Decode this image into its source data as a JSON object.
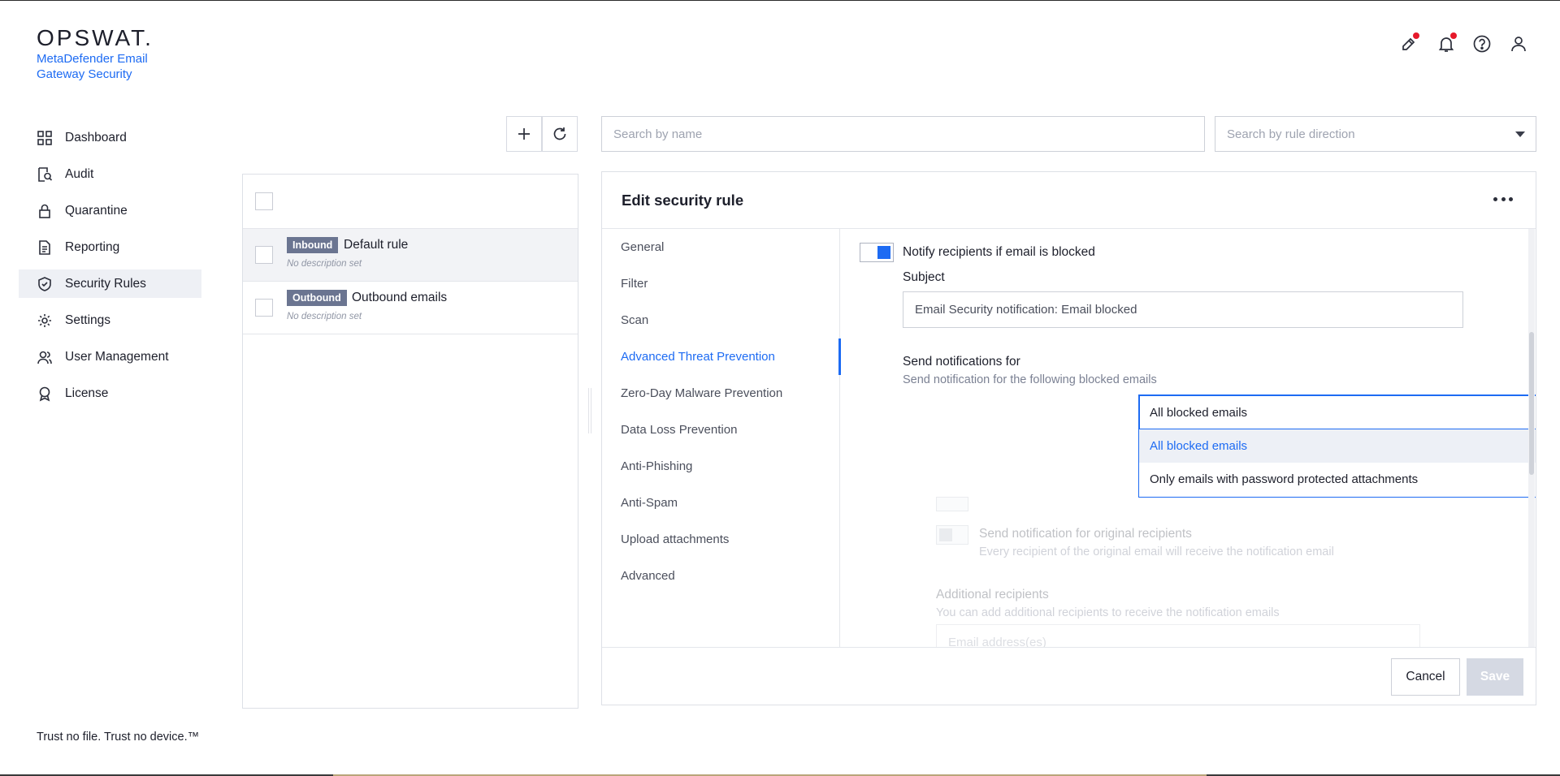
{
  "brand": {
    "logo": "OPSWAT.",
    "product": "MetaDefender Email Gateway Security",
    "tagline": "Trust no file. Trust no device.™"
  },
  "sidebar": {
    "items": [
      {
        "label": "Dashboard",
        "icon": "dashboard-icon"
      },
      {
        "label": "Audit",
        "icon": "audit-icon"
      },
      {
        "label": "Quarantine",
        "icon": "lock-icon"
      },
      {
        "label": "Reporting",
        "icon": "document-icon"
      },
      {
        "label": "Security Rules",
        "icon": "shield-check-icon",
        "active": true
      },
      {
        "label": "Settings",
        "icon": "gear-icon"
      },
      {
        "label": "User Management",
        "icon": "users-icon"
      },
      {
        "label": "License",
        "icon": "award-icon"
      }
    ]
  },
  "topbar": {
    "icons": [
      "tools-icon",
      "bell-icon",
      "help-icon",
      "user-icon"
    ],
    "notification_color": "#e6192b"
  },
  "rules": {
    "items": [
      {
        "direction": "Inbound",
        "name": "Default rule",
        "description": "No description set",
        "selected": true
      },
      {
        "direction": "Outbound",
        "name": "Outbound emails",
        "description": "No description set",
        "selected": false
      }
    ]
  },
  "search": {
    "name_placeholder": "Search by name",
    "direction_placeholder": "Search by rule direction"
  },
  "editor": {
    "title": "Edit security rule",
    "tabs": [
      "General",
      "Filter",
      "Scan",
      "Advanced Threat Prevention",
      "Zero-Day Malware Prevention",
      "Data Loss Prevention",
      "Anti-Phishing",
      "Anti-Spam",
      "Upload attachments",
      "Advanced"
    ],
    "active_tab": "Advanced Threat Prevention",
    "notify_toggle_label": "Notify recipients if email is blocked",
    "subject_label": "Subject",
    "subject_value": "Email Security notification: Email blocked",
    "send_for_label": "Send notifications for",
    "send_for_sub": "Send notification for the following blocked emails",
    "send_for_value": "All blocked emails",
    "send_for_options": [
      "All blocked emails",
      "Only emails with password protected attachments"
    ],
    "original_recipients_label": "Send notification for original recipients",
    "original_recipients_sub": "Every recipient of the original email will receive the notification email",
    "additional_label": "Additional recipients",
    "additional_sub": "You can add additional recipients to receive the notification emails",
    "additional_placeholder": "Email address(es)",
    "cancel_label": "Cancel",
    "save_label": "Save"
  },
  "colors": {
    "accent": "#1d6bf3",
    "badge": "#6b7591"
  }
}
